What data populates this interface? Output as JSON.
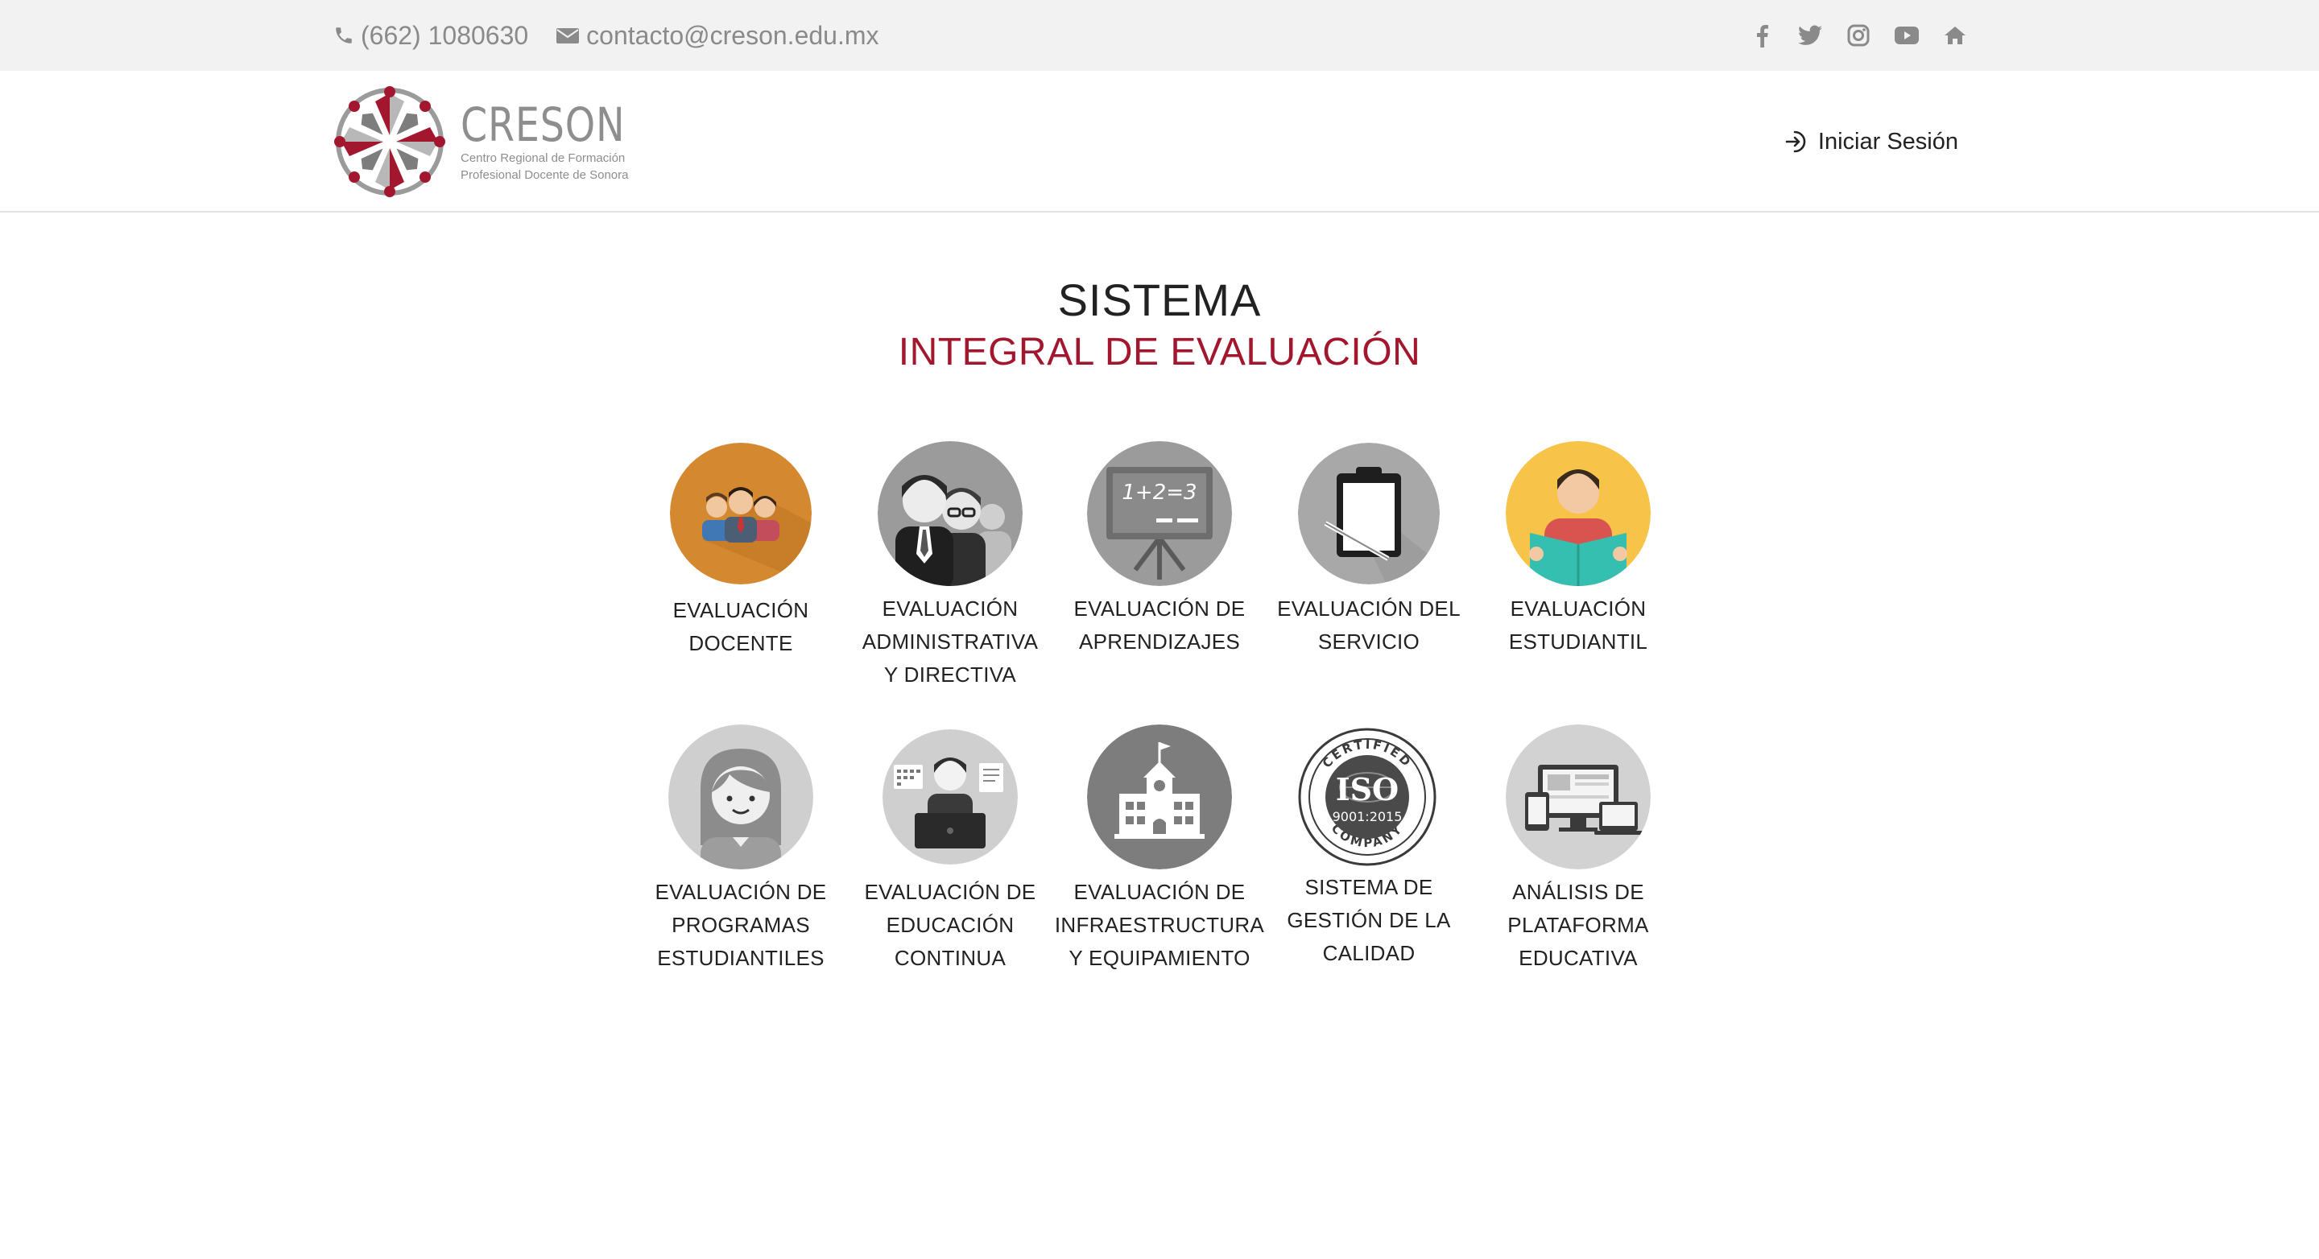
{
  "topbar": {
    "phone": "(662) 1080630",
    "email": "contacto@creson.edu.mx",
    "social_icons": [
      "facebook-icon",
      "twitter-icon",
      "instagram-icon",
      "youtube-icon",
      "home-icon"
    ]
  },
  "header": {
    "brand_name": "CRESON",
    "brand_sub_line1": "Centro Regional de Formación",
    "brand_sub_line2": "Profesional Docente de Sonora",
    "login_label": "Iniciar Sesión"
  },
  "hero": {
    "title": "SISTEMA",
    "subtitle": "INTEGRAL DE EVALUACIÓN"
  },
  "modules": [
    {
      "lines": [
        "EVALUACIÓN",
        "DOCENTE"
      ],
      "icon": "teachers-group-icon"
    },
    {
      "lines": [
        "EVALUACIÓN",
        "ADMINISTRATIVA",
        "Y DIRECTIVA"
      ],
      "icon": "executives-icon"
    },
    {
      "lines": [
        "EVALUACIÓN DE",
        "APRENDIZAJES"
      ],
      "icon": "chalkboard-icon"
    },
    {
      "lines": [
        "EVALUACIÓN DEL",
        "SERVICIO"
      ],
      "icon": "clipboard-icon"
    },
    {
      "lines": [
        "EVALUACIÓN",
        "ESTUDIANTIL"
      ],
      "icon": "student-reading-icon"
    },
    {
      "lines": [
        "EVALUACIÓN DE",
        "PROGRAMAS",
        "ESTUDIANTILES"
      ],
      "icon": "girl-student-icon"
    },
    {
      "lines": [
        "EVALUACIÓN DE",
        "EDUCACIÓN",
        "CONTINUA"
      ],
      "icon": "online-learner-icon"
    },
    {
      "lines": [
        "EVALUACIÓN DE",
        "INFRAESTRUCTURA",
        "Y EQUIPAMIENTO"
      ],
      "icon": "school-building-icon"
    },
    {
      "lines": [
        "SISTEMA DE",
        "GESTIÓN DE LA",
        "CALIDAD"
      ],
      "icon": "iso-seal-icon",
      "seal_top": "CERTIFIED",
      "seal_mid": "ISO",
      "seal_num": "9001:2015",
      "seal_bottom": "COMPANY"
    },
    {
      "lines": [
        "ANÁLISIS DE",
        "PLATAFORMA",
        "EDUCATIVA"
      ],
      "icon": "devices-icon"
    }
  ],
  "colors": {
    "accent": "#a3172e",
    "topbar_bg": "#f2f2f2",
    "icon_gray": "#8a8a8a"
  }
}
